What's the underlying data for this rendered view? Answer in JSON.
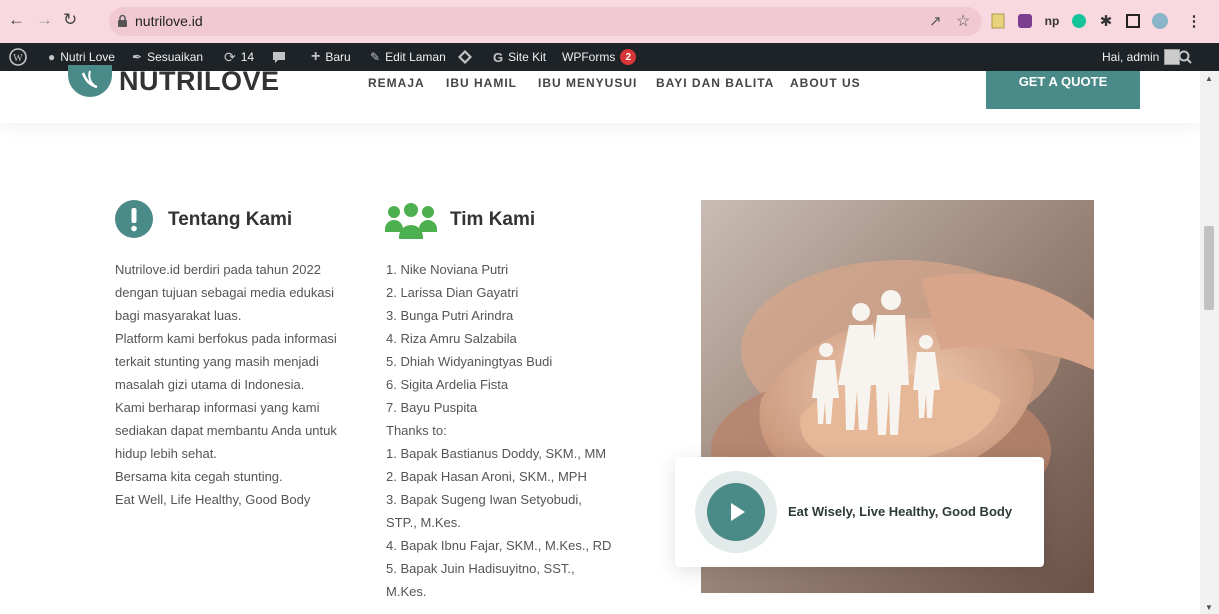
{
  "browser": {
    "url": "nutrilove.id"
  },
  "adminbar": {
    "site_name": "Nutri Love",
    "customize": "Sesuaikan",
    "updates_count": "14",
    "new": "Baru",
    "edit_page": "Edit Laman",
    "site_kit": "Site Kit",
    "wpforms": "WPForms",
    "wpforms_badge": "2",
    "greeting": "Hai, admin"
  },
  "header": {
    "logo_text": "NUTRILOVE",
    "menu": [
      "REMAJA",
      "IBU HAMIL",
      "IBU MENYUSUI",
      "BAYI DAN BALITA",
      "ABOUT US"
    ],
    "cta": "GET A QUOTE"
  },
  "about": {
    "title": "Tentang Kami",
    "lines": [
      "Nutrilove.id berdiri pada tahun 2022",
      "dengan tujuan sebagai media edukasi",
      "bagi masyarakat luas.",
      "Platform kami berfokus pada informasi",
      "terkait stunting yang masih menjadi",
      "masalah gizi utama di Indonesia.",
      "Kami berharap informasi yang kami",
      "sediakan dapat membantu Anda untuk",
      "hidup lebih sehat.",
      "Bersama kita cegah stunting.",
      "Eat Well, Life Healthy, Good Body"
    ]
  },
  "team": {
    "title": "Tim Kami",
    "lines": [
      "1. Nike Noviana Putri",
      "2. Larissa Dian Gayatri",
      "3. Bunga Putri Arindra",
      "4. Riza Amru Salzabila",
      "5. Dhiah Widyaningtyas Budi",
      "6. Sigita Ardelia Fista",
      "7. Bayu Puspita",
      "Thanks to:",
      "1. Bapak Bastianus Doddy, SKM., MM",
      "2. Bapak Hasan Aroni, SKM., MPH",
      "3. Bapak Sugeng Iwan Setyobudi,",
      "STP., M.Kes.",
      "4. Bapak Ibnu Fajar, SKM., M.Kes., RD",
      "5. Bapak Juin Hadisuyitno, SST.,",
      "M.Kes."
    ]
  },
  "video": {
    "caption": "Eat Wisely, Live Healthy, Good Body"
  },
  "colors": {
    "brand": "#4a8a88",
    "team_icon": "#4caf50",
    "chrome": "#f8d9e0",
    "adminbar": "#1d2327"
  }
}
